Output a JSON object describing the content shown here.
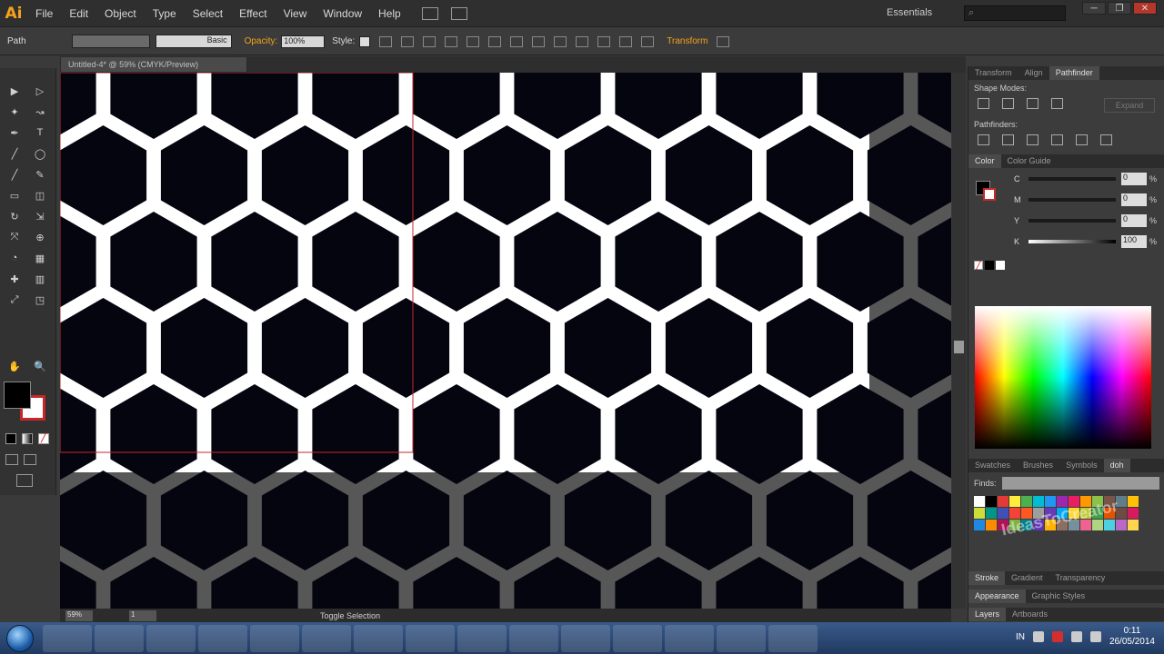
{
  "app": {
    "logo": "Ai"
  },
  "menu": [
    "File",
    "Edit",
    "Object",
    "Type",
    "Select",
    "Effect",
    "View",
    "Window",
    "Help"
  ],
  "workspace": "Essentials",
  "window_buttons": [
    "─",
    "❐",
    "✕"
  ],
  "control": {
    "selection": "Path",
    "stroke_style": "Basic",
    "opacity_label": "Opacity:",
    "opacity_value": "100%",
    "style_label": "Style:",
    "transform_label": "Transform"
  },
  "document_tab": "Untitled-4* @ 59% (CMYK/Preview)",
  "tools": [
    "▶",
    "▷",
    "✦",
    "↝",
    "✒",
    "T",
    "╱",
    "◯",
    "╱",
    "✎",
    "▭",
    "◫",
    "↻",
    "⇲",
    "⤧",
    "⊕",
    "◔",
    "▦",
    "✚",
    "▥",
    "⤢",
    "◳",
    "✋",
    "🔍"
  ],
  "fill_color": "#000000",
  "stroke_color": "#c62828",
  "bottom_bar": {
    "zoom": "59%",
    "page": "1",
    "status": "Toggle Selection"
  },
  "panels": {
    "top_tabs": [
      "Transform",
      "Align",
      "Pathfinder"
    ],
    "shape_modes_label": "Shape Modes:",
    "pathfinders_label": "Pathfinders:",
    "expand_label": "Expand",
    "color_tabs": [
      "Color",
      "Color Guide"
    ],
    "cmyk": [
      {
        "label": "C",
        "value": "0"
      },
      {
        "label": "M",
        "value": "0"
      },
      {
        "label": "Y",
        "value": "0"
      },
      {
        "label": "K",
        "value": "100"
      }
    ],
    "swatch_tabs": [
      "Swatches",
      "Brushes",
      "Symbols",
      "doh"
    ],
    "finds_label": "Finds:",
    "stroke_tabs": [
      "Stroke",
      "Gradient",
      "Transparency"
    ],
    "appearance_tabs": [
      "Appearance",
      "Graphic Styles"
    ],
    "layers_tabs": [
      "Layers",
      "Artboards"
    ],
    "swatches": [
      "#ffffff",
      "#000000",
      "#e53935",
      "#ffeb3b",
      "#4caf50",
      "#00bcd4",
      "#2196f3",
      "#9c27b0",
      "#e91e63",
      "#ff9800",
      "#8bc34a",
      "#795548",
      "#607d8b",
      "#ffc107",
      "#cddc39",
      "#009688",
      "#3f51b5",
      "#f44336",
      "#ff5722",
      "#9e9e9e",
      "#673ab7",
      "#03a9f4",
      "#fdd835",
      "#c0ca33",
      "#43a047",
      "#e65100",
      "#6d4c41",
      "#d81b60",
      "#1e88e5",
      "#fb8c00",
      "#ad1457",
      "#7cb342",
      "#00838f",
      "#5e35b1",
      "#ffb300",
      "#8d6e63",
      "#78909c",
      "#f06292",
      "#aed581",
      "#4dd0e1",
      "#ba68c8",
      "#ffd54f"
    ]
  },
  "watermark": "IdeasToCreator",
  "taskbar": {
    "lang": "IN",
    "time": "0:11",
    "date": "26/05/2014"
  }
}
